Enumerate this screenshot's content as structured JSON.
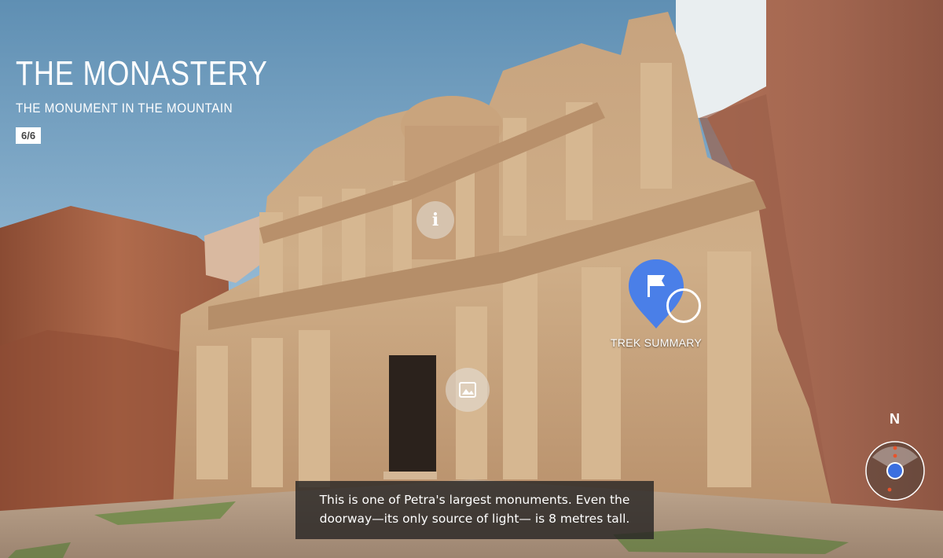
{
  "header": {
    "title": "THE MONASTERY",
    "subtitle": "THE MONUMENT IN THE MOUNTAIN",
    "counter": "6/6"
  },
  "hotspots": {
    "info_icon": "info-icon",
    "photo_icon": "image-icon"
  },
  "marker": {
    "label": "TREK SUMMARY",
    "icon": "flag-icon",
    "color": "#4a7fe8"
  },
  "caption": {
    "line1": "This is one of Petra's largest monuments. Even the",
    "line2": "doorway—its only source of light— is 8 metres tall."
  },
  "compass": {
    "north_label": "N",
    "dot_color": "#3b6fe0",
    "tick_color": "#e8542c"
  }
}
